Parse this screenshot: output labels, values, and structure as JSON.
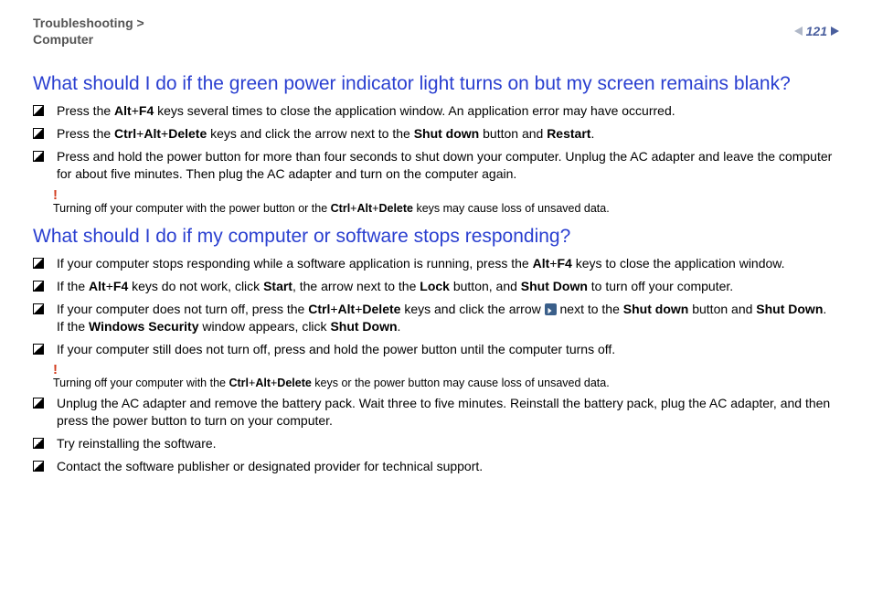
{
  "header": {
    "breadcrumb_line1": "Troubleshooting >",
    "breadcrumb_line2": "Computer",
    "page_number": "121"
  },
  "section1": {
    "title": "What should I do if the green power indicator light turns on but my screen remains blank?",
    "items": [
      "Press the <b>Alt</b>+<b>F4</b> keys several times to close the application window. An application error may have occurred.",
      "Press the <b>Ctrl</b>+<b>Alt</b>+<b>Delete</b> keys and click the arrow next to the <b>Shut down</b> button and <b>Restart</b>.",
      "Press and hold the power button for more than four seconds to shut down your computer. Unplug the AC adapter and leave the computer for about five minutes. Then plug the AC adapter and turn on the computer again."
    ],
    "warning": "Turning off your computer with the power button or the <b>Ctrl</b>+<b>Alt</b>+<b>Delete</b> keys may cause loss of unsaved data."
  },
  "section2": {
    "title": "What should I do if my computer or software stops responding?",
    "items_a": [
      "If your computer stops responding while a software application is running, press the <b>Alt</b>+<b>F4</b> keys to close the application window.",
      "If the <b>Alt</b>+<b>F4</b> keys do not work, click <b>Start</b>, the arrow next to the <b>Lock</b> button, and <b>Shut Down</b> to turn off your computer.",
      "If your computer does not turn off, press the <b>Ctrl</b>+<b>Alt</b>+<b>Delete</b> keys and click the arrow <span class=\"inline-icon\" data-name=\"arrow-icon\" data-interactable=\"false\"></span> next to the <b>Shut down</b> button and <b>Shut Down</b>.<br>If the <b>Windows Security</b> window appears, click <b>Shut Down</b>.",
      "If your computer still does not turn off, press and hold the power button until the computer turns off."
    ],
    "warning": "Turning off your computer with the <b>Ctrl</b>+<b>Alt</b>+<b>Delete</b> keys or the power button may cause loss of unsaved data.",
    "items_b": [
      "Unplug the AC adapter and remove the battery pack. Wait three to five minutes. Reinstall the battery pack, plug the AC adapter, and then press the power button to turn on your computer.",
      "Try reinstalling the software.",
      "Contact the software publisher or designated provider for technical support."
    ]
  }
}
